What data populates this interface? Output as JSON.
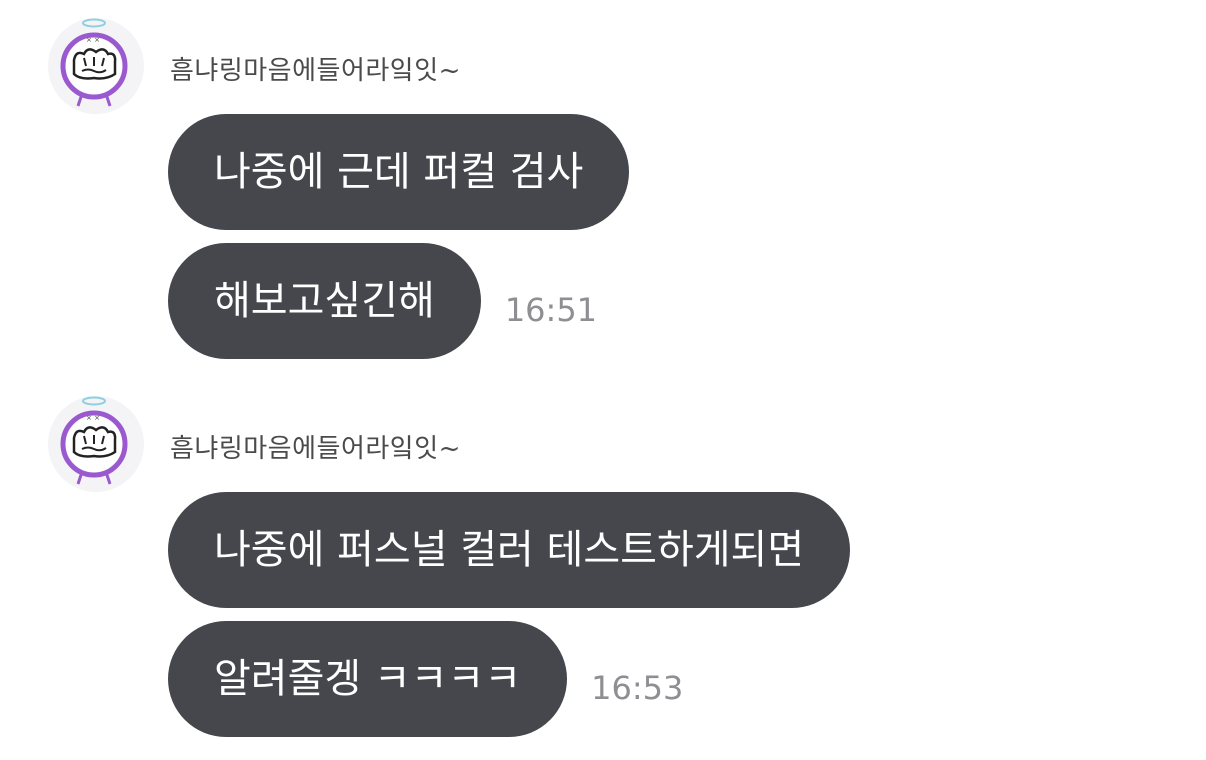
{
  "groups": [
    {
      "sender": "흠냐링마음에들어라잌잇~",
      "messages": [
        {
          "text": "나중에 근데 퍼컬 검사",
          "time": ""
        },
        {
          "text": "해보고싶긴해",
          "time": "16:51"
        }
      ]
    },
    {
      "sender": "흠냐링마음에들어라잌잇~",
      "messages": [
        {
          "text": "나중에 퍼스널 컬러 테스트하게되면",
          "time": ""
        },
        {
          "text": "알려줄겡 ㅋㅋㅋㅋ",
          "time": "16:53"
        }
      ]
    }
  ],
  "colors": {
    "bubble": "#45474d",
    "bubble_text": "#ffffff",
    "sender_text": "#4b4b4b",
    "time_text": "#8e8e93",
    "avatar_ring": "#9b59d0",
    "halo": "#8fcfe0"
  },
  "icons": {
    "avatar": "cartoon-avatar-icon"
  }
}
